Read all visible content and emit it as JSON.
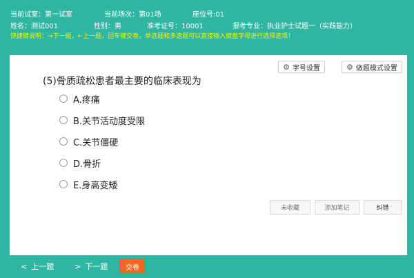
{
  "exam_info": {
    "room": "当前试室：第一试室",
    "session": "当前场次：第01场",
    "seat": "座位号:01",
    "name": "姓名：测试001",
    "gender": "性别：男",
    "ticket": "准考证号：10001",
    "major": "报考专业：执业护士试题一（实践能力）"
  },
  "hint": "快捷键说明：→下一题，←上一题，回车键交卷，单选题和多选题可以直接输入键盘字母进行选择选项！",
  "toolbar": {
    "font_setting_label": "字号设置",
    "mode_setting_label": "做题模式设置"
  },
  "question": {
    "text": "(5)骨质疏松患者最主要的临床表现为",
    "options": [
      {
        "label": "A.疼痛"
      },
      {
        "label": "B.关节活动度受限"
      },
      {
        "label": "C.关节僵硬"
      },
      {
        "label": "D.骨折"
      },
      {
        "label": "E.身高变矮"
      }
    ]
  },
  "actions": {
    "favorite_label": "未收藏",
    "note_label": "添加笔记",
    "error_label": "纠错"
  },
  "nav": {
    "prev_label": "上一题",
    "next_label": "下一题",
    "submit_label": "交卷"
  },
  "colors": {
    "background": "#2fb5a4",
    "hint": "#f5f500",
    "submit": "#f26522"
  }
}
